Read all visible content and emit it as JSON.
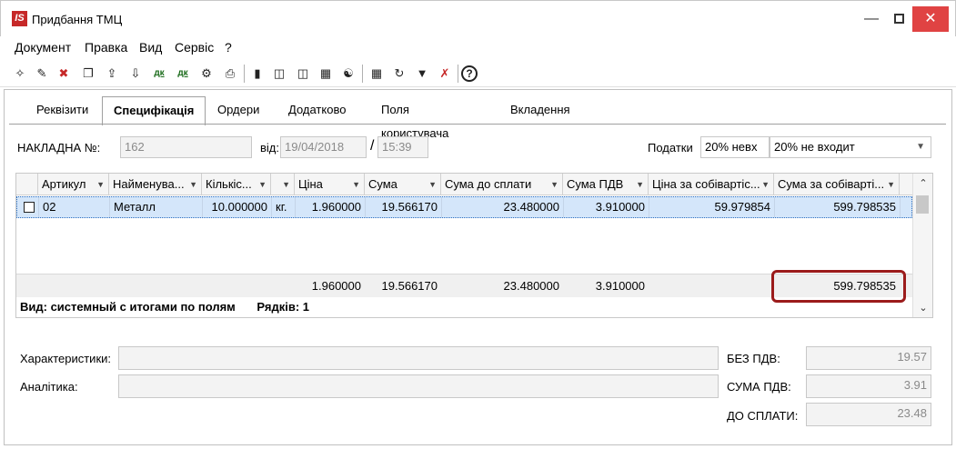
{
  "window": {
    "title": "Придбання ТМЦ",
    "logo": "IS"
  },
  "menu": [
    "Документ",
    "Правка",
    "Вид",
    "Сервіс",
    "?"
  ],
  "tabs": [
    "Реквізити",
    "Специфікація",
    "Ордери",
    "Додатково",
    "Поля користувача",
    "Вкладення"
  ],
  "active_tab": "Специфікація",
  "header": {
    "invoice_label": "НАКЛАДНА №:",
    "invoice_value": "162",
    "date_label": "від:",
    "date_value": "19/04/2018",
    "time_sep": "/",
    "time_value": "15:39",
    "taxes_label": "Податки",
    "tax_rate": "20% невх",
    "tax_mode": "20% не входит"
  },
  "grid": {
    "columns": [
      "Артикул",
      "Найменува...",
      "Кількіс...",
      "",
      "Ціна",
      "Сума",
      "Сума до сплати",
      "Сума ПДВ",
      "Ціна за собівартіс...",
      "Сума за собіварті..."
    ],
    "rows": [
      {
        "article": "02",
        "name": "Металл",
        "qty": "10.000000",
        "unit": "кг.",
        "price": "1.960000",
        "sum": "19.566170",
        "sum_to_pay": "23.480000",
        "vat_sum": "3.910000",
        "cost_price": "59.979854",
        "cost_sum": "599.798535"
      }
    ],
    "totals": {
      "price": "1.960000",
      "sum": "19.566170",
      "sum_to_pay": "23.480000",
      "vat_sum": "3.910000",
      "cost_sum": "599.798535"
    },
    "status_view": "Вид: системный с итогами по полям",
    "status_rows": "Рядків: 1"
  },
  "bottom": {
    "characteristics_label": "Характеристики:",
    "analytics_label": "Аналітика:",
    "no_vat_label": "БЕЗ ПДВ:",
    "no_vat_value": "19.57",
    "vat_label": "СУМА ПДВ:",
    "vat_value": "3.91",
    "to_pay_label": "ДО СПЛАТИ:",
    "to_pay_value": "23.48"
  },
  "toolbar": {
    "dk1": "дк",
    "dk2": "дк"
  }
}
